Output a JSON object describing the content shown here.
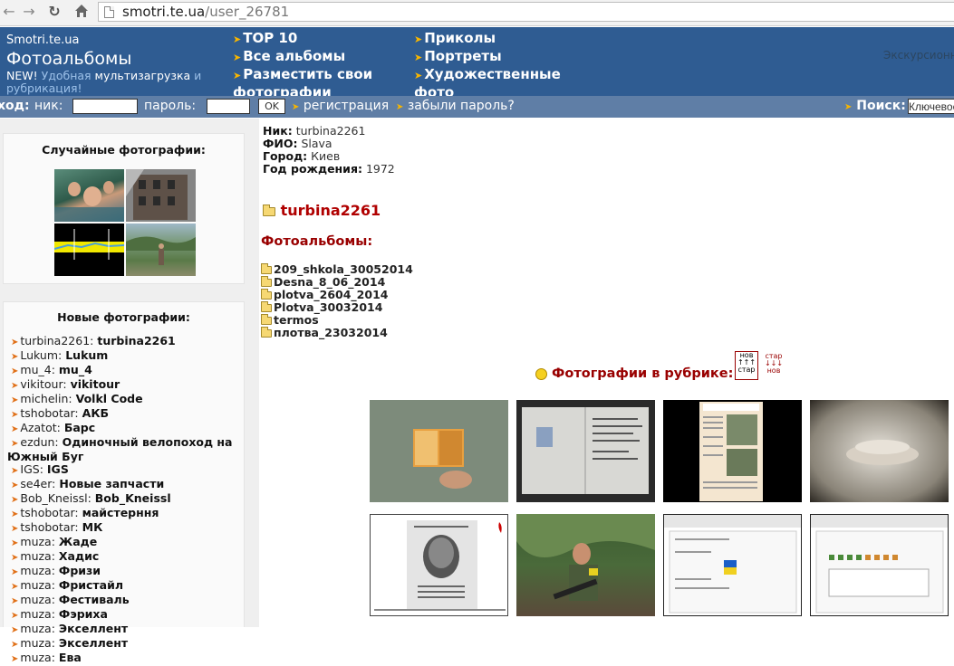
{
  "browser": {
    "url_host": "smotri.te.ua",
    "url_path": "/user_26781"
  },
  "header": {
    "site_name": "Smotri.te.ua",
    "title": "Фотоальбомы",
    "promo_new": "NEW!",
    "promo_a": " Удобная ",
    "promo_b": "мультизагрузка",
    "promo_c": " и рубрикация!",
    "menu_col1": [
      "TOP 10",
      "Все альбомы",
      "Разместить свои"
    ],
    "menu_col1_cont": "фотографии",
    "menu_col2": [
      "Приколы",
      "Портреты",
      "Художественные"
    ],
    "menu_col2_cont": "фото",
    "excursion": "Экскурсионн"
  },
  "login": {
    "label": "ход:",
    "nick_label": "ник:",
    "password_label": "пароль:",
    "ok": "OK",
    "register": "регистрация",
    "forgot": "забыли пароль?",
    "search_label": "Поиск:",
    "search_placeholder": "Ключевое"
  },
  "sidebar": {
    "random_title": "Случайные фотографии:",
    "new_title": "Новые фотографии:",
    "new_items": [
      {
        "user": "turbina2261:",
        "title": "turbina2261"
      },
      {
        "user": "Lukum:",
        "title": "Lukum"
      },
      {
        "user": "mu_4:",
        "title": "mu_4"
      },
      {
        "user": "vikitour:",
        "title": "vikitour"
      },
      {
        "user": "michelin:",
        "title": "Volkl Code"
      },
      {
        "user": "tshobotar:",
        "title": "АКБ"
      },
      {
        "user": "Azatot:",
        "title": "Барс"
      },
      {
        "user": "ezdun:",
        "title": "Одиночный велопоход на"
      },
      {
        "cont": "Южный Буг"
      },
      {
        "user": "IGS:",
        "title": "IGS"
      },
      {
        "user": "se4er:",
        "title": "Новые запчасти"
      },
      {
        "user": "Bob_Kneissl:",
        "title": "Bob_Kneissl"
      },
      {
        "user": "tshobotar:",
        "title": "майстерння"
      },
      {
        "user": "tshobotar:",
        "title": "МК"
      },
      {
        "user": "muza:",
        "title": "Жаде"
      },
      {
        "user": "muza:",
        "title": "Хадис"
      },
      {
        "user": "muza:",
        "title": "Фризи"
      },
      {
        "user": "muza:",
        "title": "Фристайл"
      },
      {
        "user": "muza:",
        "title": "Фестиваль"
      },
      {
        "user": "muza:",
        "title": "Фэриха"
      },
      {
        "user": "muza:",
        "title": "Экселлент"
      },
      {
        "user": "muza:",
        "title": "Экселлент"
      },
      {
        "user": "muza:",
        "title": "Ева"
      }
    ]
  },
  "profile": {
    "nick_label": "Ник:",
    "nick": "turbina2261",
    "fio_label": "ФИО:",
    "fio": "Slava",
    "city_label": "Город:",
    "city": "Киев",
    "birth_label": "Год рождения:",
    "birth": "1972"
  },
  "main": {
    "username": "turbina2261",
    "albums_heading": "Фотоальбомы:",
    "albums": [
      "209_shkola_30052014",
      "Desna_8_06_2014",
      "plotva_2604_2014",
      "Plotva_30032014",
      "termos",
      "плотва_23032014"
    ],
    "rubric_heading": "Фотографии в рубрике:",
    "sort_new": [
      "нов",
      "↑↑↑",
      "стар"
    ],
    "sort_old": [
      "стар",
      "↓↓↓",
      "нов"
    ]
  },
  "icons": [
    "back-icon",
    "forward-icon",
    "reload-icon",
    "home-icon",
    "page-icon",
    "folder-icon",
    "smiley-icon",
    "arrow-bullet-icon"
  ],
  "colors": {
    "header": "#2f5c92",
    "login_bar": "#5f7ea6",
    "accent_red": "#990000",
    "arrow": "#f7b500"
  }
}
